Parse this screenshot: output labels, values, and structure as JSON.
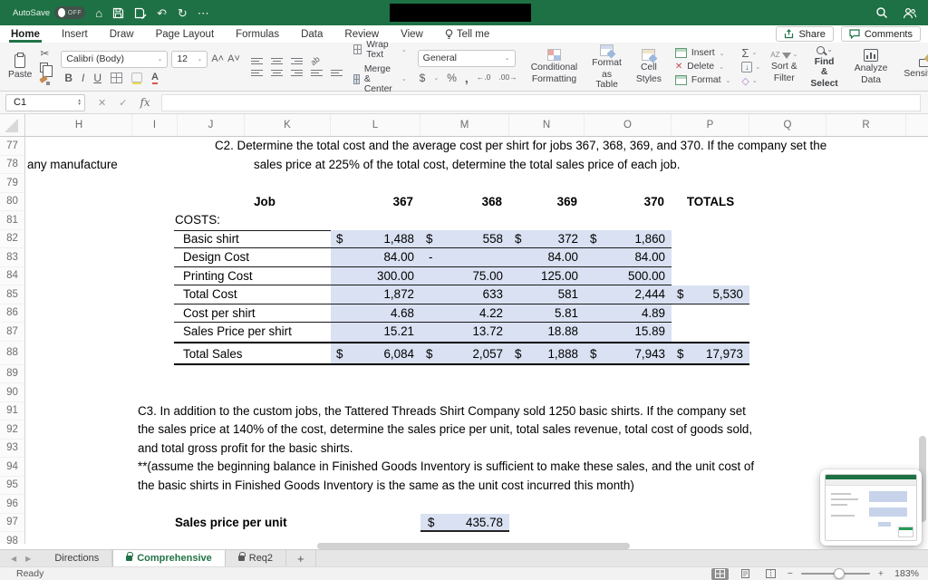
{
  "colors": {
    "accent_green": "#217346",
    "titlebar_green": "#1e7144",
    "cell_fill_blue": "#d9e1f2"
  },
  "icons": {
    "home": "⌂",
    "undo": "↶",
    "redo": "↻",
    "more": "⋯",
    "cut": "✂",
    "sum": "Σ",
    "fill_down": "↓",
    "clear": "◇",
    "bold": "B",
    "italic": "I",
    "underline": "U",
    "currency": "$",
    "percent": "%",
    "comma": ",",
    "dec_inc": "←.0",
    "dec_dec": ".00→",
    "close": "✕",
    "check": "✓",
    "fx": "fx",
    "chevron": "⌄",
    "up": "▴",
    "down": "▾",
    "left_tri": "◀",
    "right_tri": "▶",
    "plus": "+",
    "minus": "−",
    "grow_font": "A˄",
    "shrink_font": "A˅",
    "az": "AZ",
    "ab": "ab"
  },
  "titlebar": {
    "autosave": "AutoSave",
    "autosave_state": "OFF"
  },
  "menubar": {
    "tabs": [
      "Home",
      "Insert",
      "Draw",
      "Page Layout",
      "Formulas",
      "Data",
      "Review",
      "View"
    ],
    "tellme": "Tell me",
    "share": "Share",
    "comments": "Comments"
  },
  "ribbon": {
    "paste": "Paste",
    "font_name": "Calibri (Body)",
    "font_size": "12",
    "wrap_text": "Wrap Text",
    "merge_center": "Merge & Center",
    "number_format": "General",
    "conditional_l1": "Conditional",
    "conditional_l2": "Formatting",
    "format_table_l1": "Format",
    "format_table_l2": "as Table",
    "cell_styles_l1": "Cell",
    "cell_styles_l2": "Styles",
    "insert": "Insert",
    "delete": "Delete",
    "format": "Format",
    "sort_l1": "Sort &",
    "sort_l2": "Filter",
    "find_l1": "Find &",
    "find_l2": "Select",
    "analyze_l1": "Analyze",
    "analyze_l2": "Data",
    "sensitivity": "Sensitivity"
  },
  "formulabar": {
    "name_box": "C1"
  },
  "grid": {
    "columns": [
      "H",
      "I",
      "J",
      "K",
      "L",
      "M",
      "N",
      "O",
      "P",
      "Q",
      "R"
    ],
    "rows": [
      "77",
      "78",
      "79",
      "80",
      "81",
      "82",
      "83",
      "84",
      "85",
      "86",
      "87",
      "88",
      "89",
      "90",
      "91",
      "92",
      "93",
      "94",
      "95",
      "96",
      "97",
      "98"
    ]
  },
  "sheet": {
    "c2_line1": "C2. Determine the total cost and the average cost per shirt for jobs 367, 368, 369, and 370. If the company set the",
    "c2_line2": "sales price at 225% of the total cost, determine the total sales price of each job.",
    "left_fragment": "any manufacture",
    "header": {
      "job": "Job",
      "c367": "367",
      "c368": "368",
      "c369": "369",
      "c370": "370",
      "totals": "TOTALS"
    },
    "costs_heading": "COSTS:",
    "table": {
      "basic_shirt": {
        "label": "Basic shirt",
        "cur": "$",
        "v367": "1,488",
        "v368": "558",
        "v369": "372",
        "v370": "1,860"
      },
      "design_cost": {
        "label": "Design Cost",
        "v367": "84.00",
        "v368": "-",
        "v369": "84.00",
        "v370": "84.00"
      },
      "printing_cost": {
        "label": "Printing Cost",
        "v367": "300.00",
        "v368": "75.00",
        "v369": "125.00",
        "v370": "500.00"
      },
      "total_cost": {
        "label": "Total Cost",
        "v367": "1,872",
        "v368": "633",
        "v369": "581",
        "v370": "2,444",
        "cur": "$",
        "total": "5,530"
      },
      "cost_per_shirt": {
        "label": "Cost per shirt",
        "v367": "4.68",
        "v368": "4.22",
        "v369": "5.81",
        "v370": "4.89"
      },
      "sales_price_per_shirt": {
        "label": "Sales Price per shirt",
        "v367": "15.21",
        "v368": "13.72",
        "v369": "18.88",
        "v370": "15.89"
      },
      "total_sales": {
        "label": "Total Sales",
        "cur": "$",
        "v367": "6,084",
        "v368": "2,057",
        "v369": "1,888",
        "v370": "7,943",
        "total": "17,973"
      }
    },
    "c3_line1": "C3. In addition to the custom jobs, the Tattered Threads Shirt Company sold 1250  basic shirts. If the company set",
    "c3_line2": "the sales price at 140% of the cost, determine the sales price per unit, total sales revenue, total cost of goods sold,",
    "c3_line3": "and total gross profit for the basic shirts.",
    "c3_line4": "**(assume the beginning balance in Finished Goods Inventory is sufficient to make these sales, and the unit cost of",
    "c3_line5": "the basic shirts in Finished Goods Inventory is the same as the unit cost incurred this month)",
    "sales_price_unit": {
      "label": "Sales price per unit",
      "cur": "$",
      "value": "435.78"
    }
  },
  "tabbar": {
    "tabs": [
      {
        "label": "Directions"
      },
      {
        "label": "Comprehensive"
      },
      {
        "label": "Req2"
      }
    ]
  },
  "statusbar": {
    "ready": "Ready",
    "zoom": "183%"
  }
}
